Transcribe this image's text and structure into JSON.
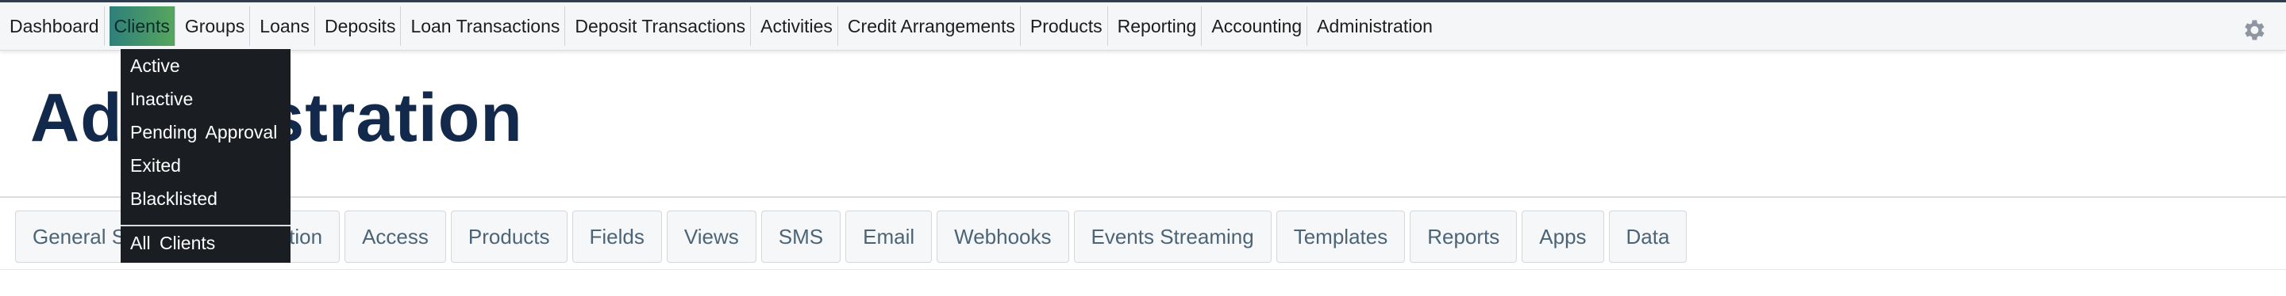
{
  "nav": {
    "items": [
      {
        "label": "Dashboard"
      },
      {
        "label": "Clients",
        "active": true
      },
      {
        "label": "Groups"
      },
      {
        "label": "Loans"
      },
      {
        "label": "Deposits"
      },
      {
        "label": "Loan Transactions"
      },
      {
        "label": "Deposit Transactions"
      },
      {
        "label": "Activities"
      },
      {
        "label": "Credit Arrangements"
      },
      {
        "label": "Products"
      },
      {
        "label": "Reporting"
      },
      {
        "label": "Accounting"
      },
      {
        "label": "Administration"
      }
    ],
    "settings_icon": "gear-icon",
    "active_color": "#3b8f6d"
  },
  "clients_menu": {
    "items": [
      "Active",
      "Inactive",
      "Pending Approval",
      "Exited",
      "Blacklisted"
    ],
    "footer_item": "All Clients"
  },
  "page": {
    "title": "Administration"
  },
  "admin_tabs": [
    "General Setup",
    "Organization",
    "Access",
    "Products",
    "Fields",
    "Views",
    "SMS",
    "Email",
    "Webhooks",
    "Events Streaming",
    "Templates",
    "Reports",
    "Apps",
    "Data"
  ]
}
